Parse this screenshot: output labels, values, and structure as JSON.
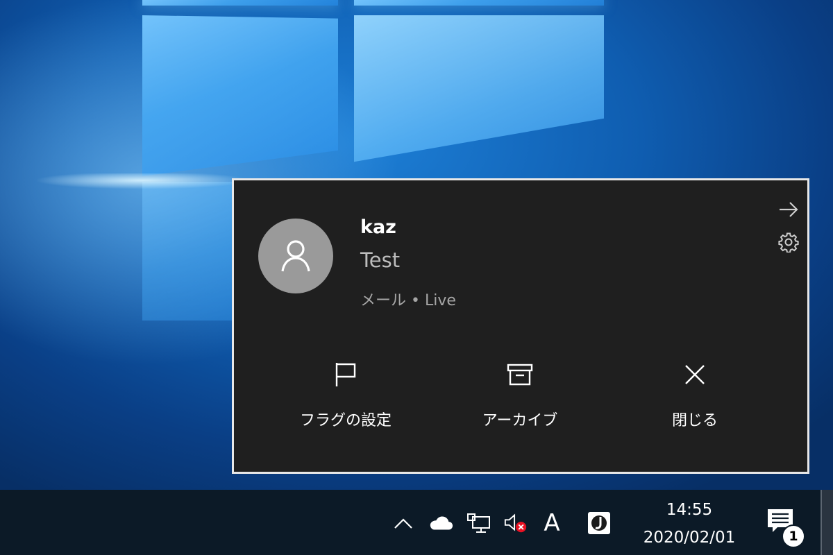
{
  "notification": {
    "sender": "kaz",
    "subject": "Test",
    "source": "メール • Live",
    "actions": [
      {
        "label": "フラグの設定",
        "icon": "flag-icon"
      },
      {
        "label": "アーカイブ",
        "icon": "archive-icon"
      },
      {
        "label": "閉じる",
        "icon": "close-icon"
      }
    ],
    "avatar_icon": "person-icon",
    "dismiss_icon": "arrow-right-icon",
    "settings_icon": "gear-icon"
  },
  "taskbar": {
    "time": "14:55",
    "date": "2020/02/01",
    "ime_indicator": "A",
    "notification_count": "1",
    "tray_icons": [
      "chevron-up-icon",
      "onedrive-cloud-icon",
      "network-icon",
      "volume-muted-icon",
      "ime-icon",
      "app-icon"
    ]
  },
  "colors": {
    "toast_background": "#1f1f1f",
    "toast_border": "#e8e8e8",
    "taskbar_background": "#0c1a27",
    "avatar_background": "#9a9a9a",
    "muted_badge": "#e81123"
  }
}
